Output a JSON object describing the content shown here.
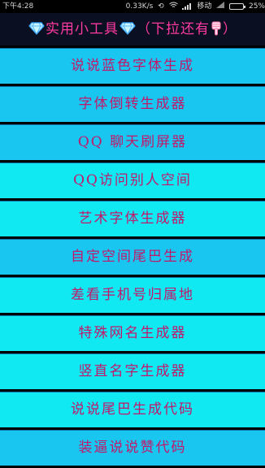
{
  "status_bar": {
    "time": "下午4:28",
    "speed": "0.33K/s",
    "carrier": "移动",
    "battery": "25%"
  },
  "header": {
    "title": "实用小工具",
    "hint": "（下拉还有",
    "hint_close": "）",
    "title_color": "#ff3aa0"
  },
  "menu": {
    "items": [
      {
        "label": "说说蓝色字体生成"
      },
      {
        "label": "字体倒转生成器"
      },
      {
        "label": "QQ  聊天刷屏器"
      },
      {
        "label": "QQ访问别人空间"
      },
      {
        "label": "艺术字体生成器"
      },
      {
        "label": "自定空间尾巴生成"
      },
      {
        "label": "差看手机号归属地"
      },
      {
        "label": "特殊网名生成器"
      },
      {
        "label": "竖直名字生成器"
      },
      {
        "label": "说说尾巴生成代码"
      },
      {
        "label": "装逼说说赞代码"
      }
    ],
    "colors": {
      "item_a": "#19c6ef",
      "item_b": "#10e8f2",
      "text": "#c2186b"
    }
  }
}
